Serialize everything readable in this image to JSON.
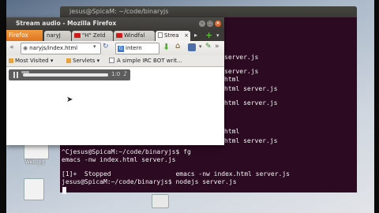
{
  "terminal": {
    "title": "jesus@SpicaM: ~/code/binaryjs",
    "lines": [
      "server.js",
      "server.js",
      "html",
      "html server.js",
      "html server.js",
      "html",
      "html server.js",
      "^Cjesus@SpicaM:~/code/binaryjs$ fg",
      "emacs -nw index.html server.js",
      "[1]+  Stopped                 emacs -nw index.html server.js",
      "jesus@SpicaM:~/code/binaryjs$ nodejs server.js"
    ]
  },
  "firefox": {
    "title": "Stream audio - Mozilla Firefox",
    "menu_label": "Firefox",
    "tabs": [
      "naryJ",
      "\"H\" Zeld",
      "Windfal",
      "Strea"
    ],
    "url": "naryjs/index.html",
    "search_engine": "intern",
    "bookmarks": [
      "Most Visited ▾",
      "Servlets ▾",
      "A simple IRC BOT writ..."
    ],
    "player_time": "1:0"
  },
  "desktop": {
    "icon_label": "Web.jpg"
  },
  "colors": {
    "terminal_bg": "#2c0a22",
    "firefox_orange": "#e0721f"
  }
}
